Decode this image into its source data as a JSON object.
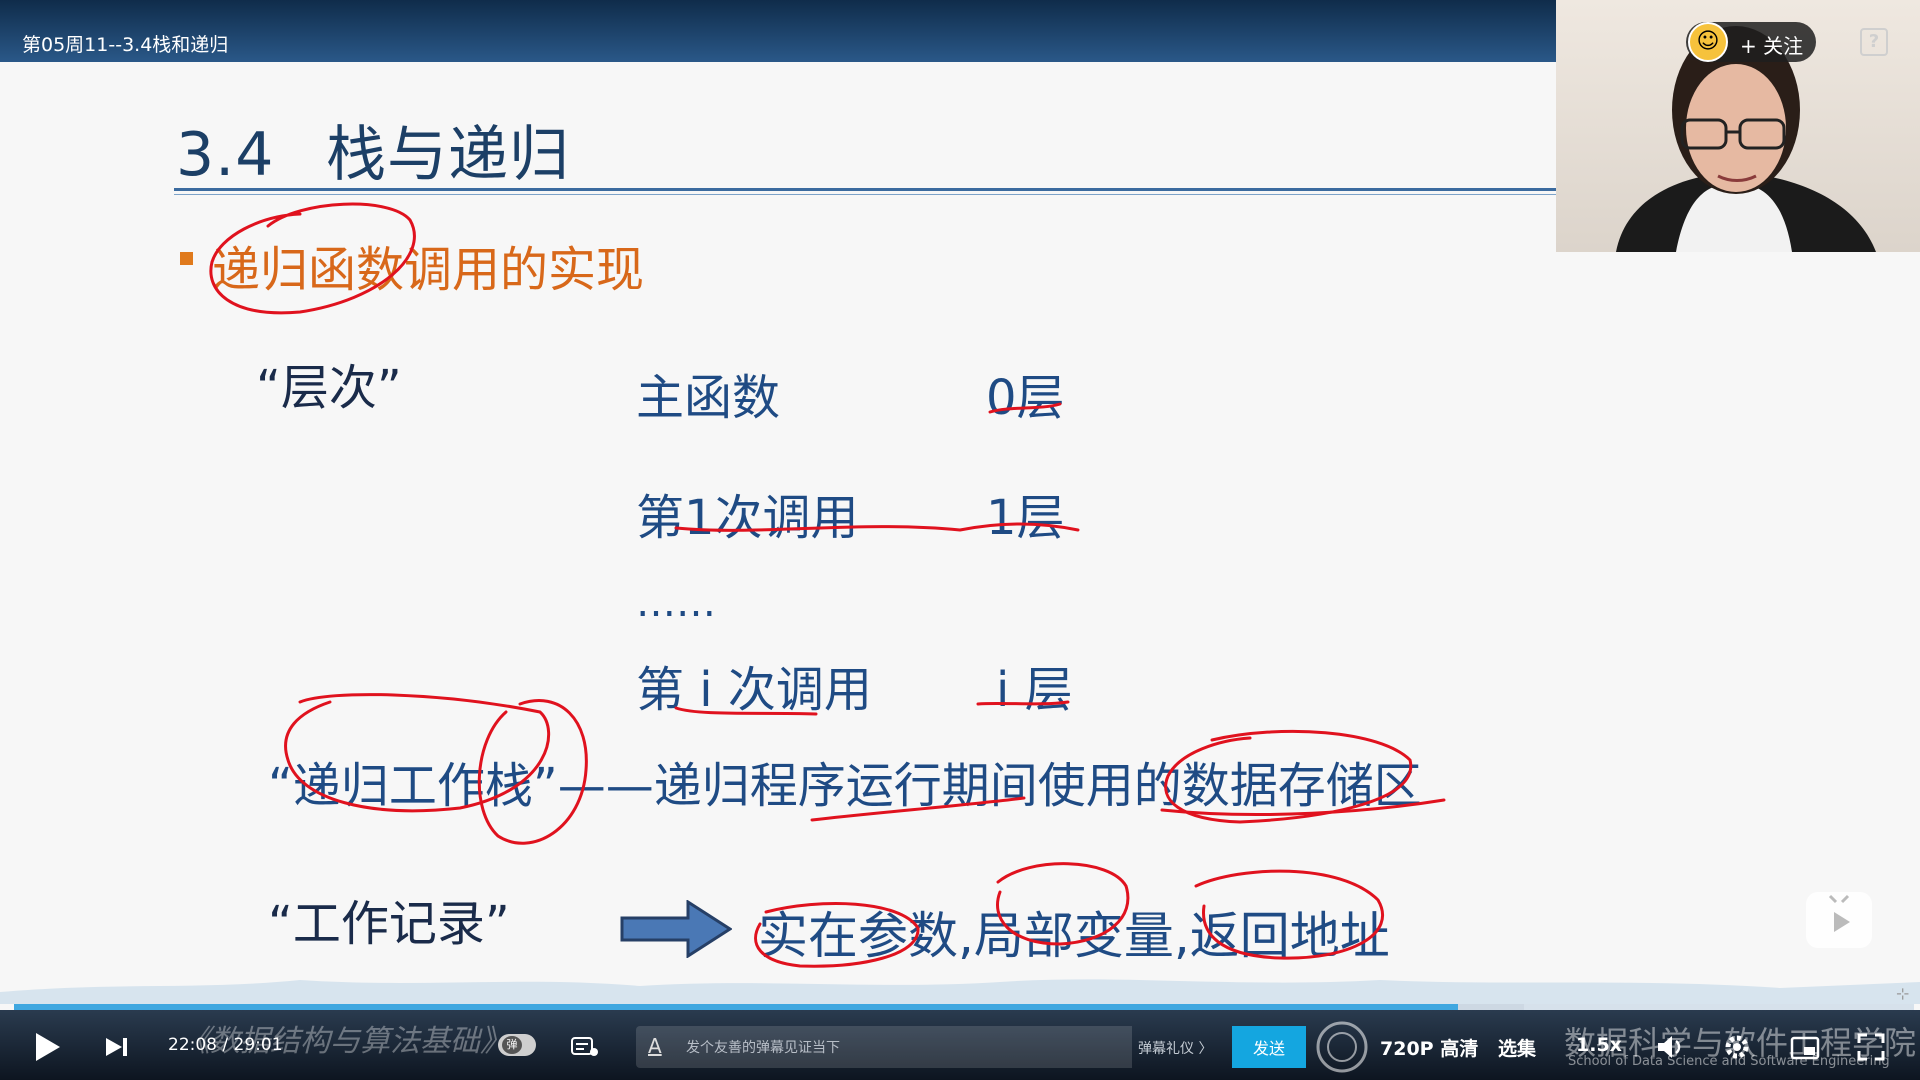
{
  "video": {
    "title": "第05周11--3.4栈和递归"
  },
  "slide": {
    "heading_num": "3.4",
    "heading_text": "栈与递归",
    "bullet": "递归函数调用的实现",
    "layer_label": "“层次”",
    "rows": [
      {
        "call": "主函数",
        "layer": "0层"
      },
      {
        "call": "第1次调用",
        "layer": "1层"
      },
      {
        "call": "第 i 次调用",
        "layer": "i 层"
      }
    ],
    "ellipsis": "……",
    "stack_line": "“递归工作栈”——递归程序运行期间使用的数据存储区",
    "record_label": "“工作记录”",
    "record_items": "实在参数,局部变量,返回地址",
    "accent_colors": {
      "heading": "#1c3f66",
      "bullet": "#e07a1c",
      "ink": "#e0121e"
    }
  },
  "overlay": {
    "follow_label": "+ 关注",
    "help": "?"
  },
  "player": {
    "progress": 0.76,
    "current_time": "22:08",
    "time_separator": "/",
    "total_time": "29:01",
    "course_watermark": "《数据结构与算法基础》",
    "danmaku_badge": "弹",
    "danmaku_placeholder": "发个友善的弹幕见证当下",
    "danmaku_etiquette": "弹幕礼仪 〉",
    "send_label": "发送",
    "quality_label": "720P 高清",
    "episodes_label": "选集",
    "speed_label": "1.5x",
    "school_name": "数据科学与软件工程学院",
    "school_name_en": "School of Data Science and Software Engineering",
    "icons": [
      "play-icon",
      "next-icon",
      "danmaku-toggle",
      "danmaku-settings-icon",
      "volume-icon",
      "settings-gear-icon",
      "picture-in-picture-icon",
      "fullscreen-icon",
      "tv-icon"
    ]
  }
}
